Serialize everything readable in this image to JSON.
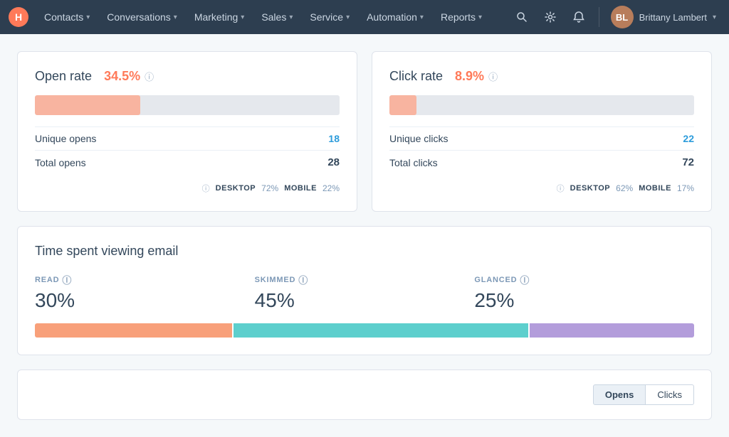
{
  "nav": {
    "logo_text": "H",
    "items": [
      {
        "label": "Contacts",
        "id": "contacts"
      },
      {
        "label": "Conversations",
        "id": "conversations"
      },
      {
        "label": "Marketing",
        "id": "marketing"
      },
      {
        "label": "Sales",
        "id": "sales"
      },
      {
        "label": "Service",
        "id": "service"
      },
      {
        "label": "Automation",
        "id": "automation"
      },
      {
        "label": "Reports",
        "id": "reports"
      }
    ],
    "user_name": "Brittany Lambert",
    "user_initials": "BL"
  },
  "open_rate_card": {
    "title_prefix": "Open rate",
    "percentage": "34.5%",
    "info": "i",
    "bar_width_pct": 34.5,
    "unique_opens_label": "Unique opens",
    "unique_opens_value": "18",
    "total_opens_label": "Total opens",
    "total_opens_value": "28",
    "footer_info": "i",
    "desktop_label": "DESKTOP",
    "desktop_value": "72%",
    "mobile_label": "MOBILE",
    "mobile_value": "22%"
  },
  "click_rate_card": {
    "title_prefix": "Click rate",
    "percentage": "8.9%",
    "info": "i",
    "bar_width_pct": 8.9,
    "unique_clicks_label": "Unique clicks",
    "unique_clicks_value": "22",
    "total_clicks_label": "Total clicks",
    "total_clicks_value": "72",
    "footer_info": "i",
    "desktop_label": "DESKTOP",
    "desktop_value": "62%",
    "mobile_label": "MOBILE",
    "mobile_value": "17%"
  },
  "time_card": {
    "title": "Time spent viewing email",
    "read_label": "READ",
    "read_pct": "30%",
    "read_pct_num": 30,
    "skimmed_label": "SKIMMED",
    "skimmed_pct": "45%",
    "skimmed_pct_num": 45,
    "glanced_label": "GLANCED",
    "glanced_pct": "25%",
    "glanced_pct_num": 25,
    "bar_colors": {
      "read": "#f8a07a",
      "skimmed": "#5dcfcd",
      "glanced": "#b39ddb"
    }
  },
  "bottom_card": {
    "opens_label": "Opens",
    "clicks_label": "Clicks"
  }
}
